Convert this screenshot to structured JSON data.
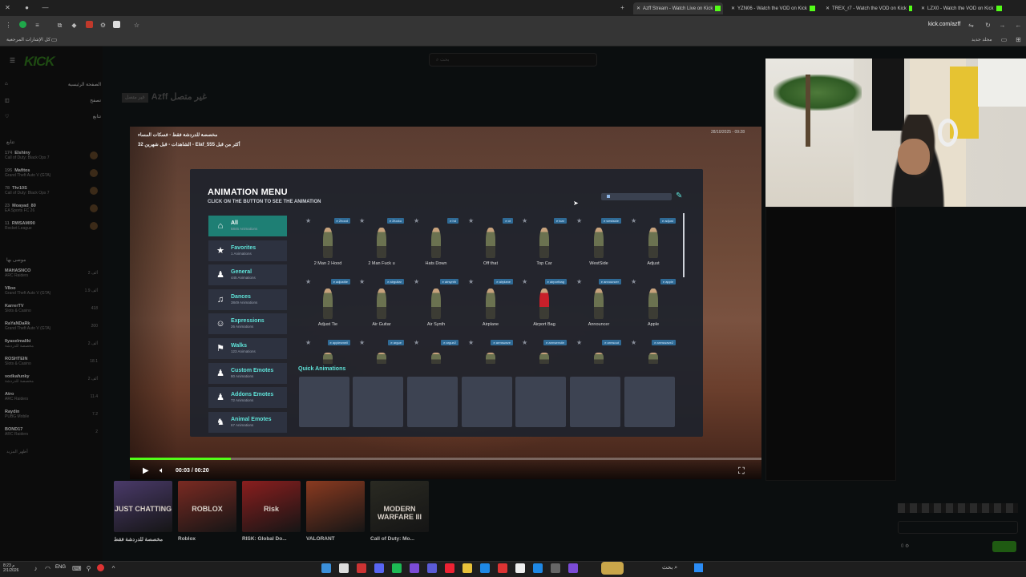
{
  "browser": {
    "tabs": [
      {
        "label": "Azff Stream - Watch Live on Kick"
      },
      {
        "label": "YZN06 - Watch the VOD on Kick"
      },
      {
        "label": "TREX_r7 - Watch the VOD on Kick"
      },
      {
        "label": "LZX0 - Watch the VOD on Kick"
      }
    ],
    "url": "kick.com/azff",
    "bookmark": "كل الإشارات المرجعية",
    "new_folder": "مجلد جديد"
  },
  "kick": {
    "logo": "KICK",
    "search_placeholder": "بحث",
    "nav": [
      "الصفحة الرئيسية",
      "تصفح",
      "تتابع"
    ],
    "following_header": "تتابع",
    "channels": [
      {
        "viewers": "174",
        "name": "Elshiny",
        "game": "Call of Duty: Black Ops 7"
      },
      {
        "viewers": "195",
        "name": "Mafitos",
        "game": "Grand Theft Auto V (GTA)"
      },
      {
        "viewers": "78",
        "name": "Thr10S",
        "game": "Call of Duty: Black Ops 7"
      },
      {
        "viewers": "23",
        "name": "Moayad_80",
        "game": "EA Sports FC 26"
      },
      {
        "viewers": "11",
        "name": "RWSAMI90",
        "game": "Rocket League"
      }
    ],
    "recommended_header": "موصى بها",
    "recommended": [
      {
        "viewers": "2 ألف",
        "name": "MAHASNCO",
        "game": "ARC Raiders"
      },
      {
        "viewers": "1.9 ألف",
        "name": "V8oo",
        "game": "Grand Theft Auto V (GTA)"
      },
      {
        "viewers": "418",
        "name": "KarrerTV",
        "game": "Slots & Casino"
      },
      {
        "viewers": "200",
        "name": "RaYaNDaRk",
        "game": "Grand Theft Auto V (GTA)"
      },
      {
        "viewers": "2 ألف",
        "name": "Ilyaselmaliki",
        "game": "مخصصة للدردشة"
      },
      {
        "viewers": "18.1",
        "name": "ROSHTEIN",
        "game": "Slots & Casino"
      },
      {
        "viewers": "2 ألف",
        "name": "vodkafunky",
        "game": "مخصصة للدردشة"
      },
      {
        "viewers": "11.4",
        "name": "Atro",
        "game": "ARC Raiders"
      },
      {
        "viewers": "7.2",
        "name": "Raydin",
        "game": "PUBG Mobile"
      },
      {
        "viewers": "2",
        "name": "BOND17",
        "game": "ARC Raiders"
      }
    ],
    "show_more": "أظهر المزيد",
    "channel_name": "Azff",
    "offline_text": "غير متصل",
    "offline_badge": "غير متصل"
  },
  "video": {
    "title_line1": "مخصصة للدردشة فقط - فسكات المساء",
    "title_line2": "الشاهدات - قبل شهرين 32 - Elaf_555 أكثر من قبل",
    "date": "28/10/2025 - 09:28",
    "time": "00:03 / 00:20",
    "progress": 0.16
  },
  "menu": {
    "title": "ANIMATION MENU",
    "subtitle": "CLICK ON THE BUTTON TO SEE THE ANIMATION",
    "categories": [
      {
        "name": "All",
        "count": "5846 Animations",
        "icon": "home-icon"
      },
      {
        "name": "Favorites",
        "count": "1 Animations",
        "icon": "star-icon"
      },
      {
        "name": "General",
        "count": "445 Animations",
        "icon": "person-icon"
      },
      {
        "name": "Dances",
        "count": "3849 Animations",
        "icon": "dance-icon"
      },
      {
        "name": "Expressions",
        "count": "26 Animations",
        "icon": "smile-icon"
      },
      {
        "name": "Walks",
        "count": "123 Animations",
        "icon": "walk-icon"
      },
      {
        "name": "Custom Emotes",
        "count": "80 Animations",
        "icon": "person-icon"
      },
      {
        "name": "Addons Emotes",
        "count": "72 Animations",
        "icon": "person-icon"
      },
      {
        "name": "Animal Emotes",
        "count": "67 Animations",
        "icon": "animal-icon"
      }
    ],
    "animations_row1": [
      {
        "label": "2 Man 2 Hood",
        "tag": "e 2hood"
      },
      {
        "label": "2 Man Fuck u",
        "tag": "e 2fucku"
      },
      {
        "label": "Hats Down",
        "tag": "e hd"
      },
      {
        "label": "Off that",
        "tag": "e ot"
      },
      {
        "label": "Top Car",
        "tag": "e tcar"
      },
      {
        "label": "WestSide",
        "tag": "e westside"
      },
      {
        "label": "Adjust",
        "tag": "e adjust"
      }
    ],
    "animations_row2": [
      {
        "label": "Adjust Tie",
        "tag": "e adjusttie"
      },
      {
        "label": "Air Guitar",
        "tag": "e airguitar"
      },
      {
        "label": "Air Synth",
        "tag": "e airsynth"
      },
      {
        "label": "Airplane",
        "tag": "e airplane"
      },
      {
        "label": "Airport Bag",
        "tag": "e airportbag"
      },
      {
        "label": "Announcer",
        "tag": "e announcer"
      },
      {
        "label": "Apple",
        "tag": "e apple"
      }
    ],
    "animations_row3_tags": [
      "e applesmell",
      "e argue",
      "e argue2",
      "e armswave",
      "e armwrestle",
      "e armsout",
      "e armswave2"
    ],
    "quick_title": "Quick Animations"
  },
  "categories_row": [
    {
      "name": "مخصصة للدردشة فقط",
      "art": "JUST CHATTING",
      "color": "#4a3a6a"
    },
    {
      "name": "Roblox",
      "art": "ROBLOX",
      "color": "#7a2a22"
    },
    {
      "name": "RISK: Global Do...",
      "art": "Risk",
      "color": "#8a1e1e"
    },
    {
      "name": "VALORANT",
      "art": "",
      "color": "#8a3a20"
    },
    {
      "name": "Call of Duty: Mo...",
      "art": "MODERN WARFARE III",
      "color": "#2a2a22"
    }
  ],
  "taskbar": {
    "lang": "ENG",
    "search": "بحث",
    "clock": "8:23 م",
    "date": "2/1/2026"
  }
}
